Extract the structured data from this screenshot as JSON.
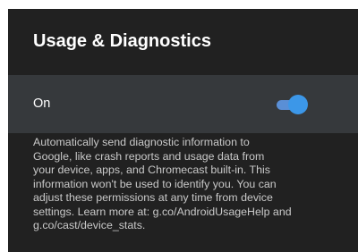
{
  "header": {
    "title": "Usage & Diagnostics"
  },
  "setting": {
    "label": "On",
    "enabled": true,
    "accent_color": "#3c97e8"
  },
  "description": {
    "lines": [
      "Automatically send diagnostic information to",
      "Google, like crash reports and usage data from",
      "your device, apps, and Chromecast built-in. This",
      "information won't be used to identify you. You can",
      "adjust these permissions at any time from device",
      "settings. Learn more at: g.co/AndroidUsageHelp and",
      "g.co/cast/device_stats."
    ]
  }
}
